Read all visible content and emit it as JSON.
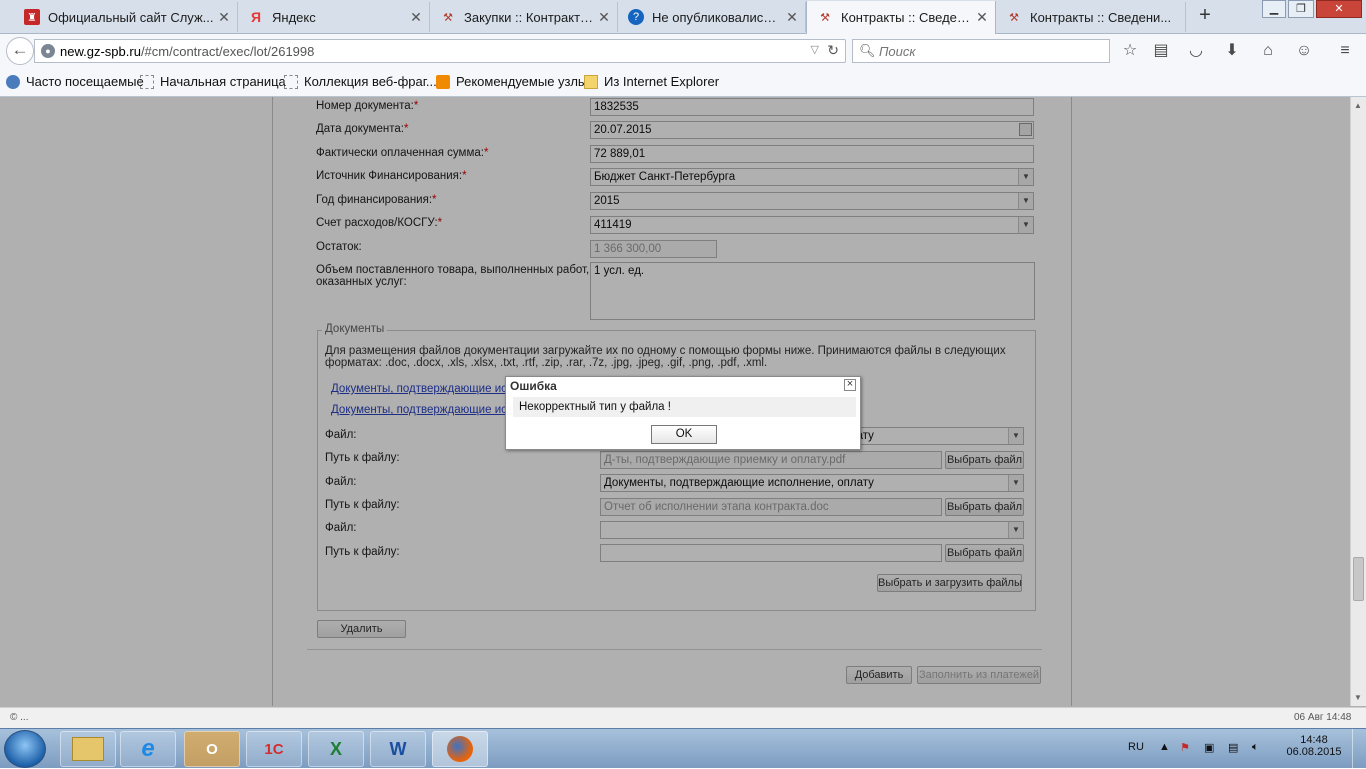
{
  "browser": {
    "tabs": [
      {
        "title": "Официальный сайт Служ...",
        "favicon": "coat-of-arms-icon",
        "active": false
      },
      {
        "title": "Яндекс",
        "favicon": "yandex-icon",
        "active": false
      },
      {
        "title": "Закупки :: Контракты ...",
        "favicon": "hammer-icon",
        "active": false
      },
      {
        "title": "Не опубликовались ф...",
        "favicon": "help-icon",
        "active": false
      },
      {
        "title": "Контракты :: Сведени...",
        "favicon": "hammer-icon",
        "active": true
      },
      {
        "title": "Контракты :: Сведени...",
        "favicon": "hammer-icon",
        "active": false
      }
    ],
    "url_host": "new.gz-spb.ru",
    "url_path": "/#cm/contract/exec/lot/261998",
    "search_placeholder": "Поиск",
    "bookmarks": [
      {
        "label": "Часто посещаемые",
        "icon": "globe-icon"
      },
      {
        "label": "Начальная страница",
        "icon": "page-icon"
      },
      {
        "label": "Коллекция веб-фраг...",
        "icon": "page-icon"
      },
      {
        "label": "Рекомендуемые узлы",
        "icon": "bulb-icon"
      },
      {
        "label": "Из Internet Explorer",
        "icon": "folder-icon"
      }
    ]
  },
  "form": {
    "doc_number": {
      "label": "Номер документа:",
      "value": "1832535"
    },
    "doc_date": {
      "label": "Дата документа:",
      "value": "20.07.2015"
    },
    "paid_sum": {
      "label": "Фактически оплаченная сумма:",
      "value": "72 889,01"
    },
    "funding_source": {
      "label": "Источник Финансирования:",
      "value": "Бюджет Санкт-Петербурга"
    },
    "funding_year": {
      "label": "Год финансирования:",
      "value": "2015"
    },
    "expense_account": {
      "label": "Счет расходов/КОСГУ:",
      "value": "411419"
    },
    "balance": {
      "label": "Остаток:",
      "value": "1 366 300,00"
    },
    "volume": {
      "label_line1": "Объем поставленного товара, выполненных работ,",
      "label_line2": "оказанных услуг:",
      "value": "1 усл. ед."
    },
    "required_mark": "*"
  },
  "documents": {
    "legend": "Документы",
    "hint_line1": "Для размещения файлов документации загружайте их по одному с помощью формы ниже. Принимаются файлы в следующих",
    "hint_line2": "форматах: .doc, .docx, .xls, .xlsx, .txt, .rtf, .zip, .rar, .7z, .jpg, .jpeg, .gif, .png, .pdf, .xml.",
    "links": [
      "Документы, подтверждающие исполнение, оплату",
      "Документы, подтверждающие исполнение, оплату"
    ],
    "file_label": "Файл:",
    "path_label": "Путь к файлу:",
    "rows": [
      {
        "file_type": "Документы, подтверждающие исполнение, оплату",
        "path": "Д-ты, подтверждающие приемку и оплату.pdf"
      },
      {
        "file_type": "Документы, подтверждающие исполнение, оплату",
        "path": "Отчет об исполнении этапа контракта.doc"
      },
      {
        "file_type": "",
        "path": ""
      }
    ],
    "choose_file": "Выбрать файл",
    "choose_upload": "Выбрать и загрузить файлы"
  },
  "actions": {
    "delete": "Удалить",
    "add": "Добавить",
    "fill_from_payments": "Заполнить из платежей"
  },
  "dialog": {
    "title": "Ошибка",
    "message": "Некорректный тип у файла !",
    "ok": "OK"
  },
  "status": {
    "left": "© ...",
    "right": "06 Авг 14:48"
  },
  "taskbar": {
    "lang": "RU",
    "time": "14:48",
    "date": "06.08.2015",
    "apps": [
      {
        "icon": "explorer-icon",
        "label": ""
      },
      {
        "icon": "internet-explorer-icon",
        "label": "e"
      },
      {
        "icon": "outlook-icon",
        "label": "O"
      },
      {
        "icon": "1c-icon",
        "label": "1С"
      },
      {
        "icon": "excel-icon",
        "label": "X"
      },
      {
        "icon": "word-icon",
        "label": "W"
      },
      {
        "icon": "firefox-icon",
        "label": ""
      }
    ]
  }
}
